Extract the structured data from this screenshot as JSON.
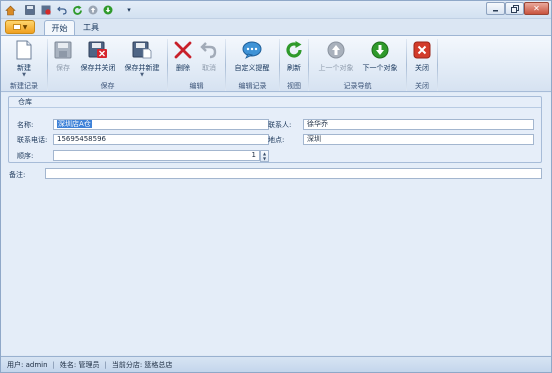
{
  "titlebar": {
    "controls": [
      "minimize",
      "restore",
      "close"
    ],
    "close_glyph": "✕"
  },
  "tabs": [
    {
      "label": "开始",
      "active": true
    },
    {
      "label": "工具",
      "active": false
    }
  ],
  "ribbon": {
    "groups": {
      "new_record": "新建记录",
      "save": "保存",
      "edit": "编辑",
      "edit_record": "编辑记录",
      "view": "视图",
      "record_nav": "记录导航",
      "close": "关闭"
    },
    "buttons": {
      "new": "新建",
      "save": "保存",
      "save_close": "保存并关闭",
      "save_new": "保存并新建",
      "delete": "删除",
      "cancel": "取消",
      "custom_hint": "自定义提醒",
      "refresh": "刷新",
      "prev": "上一个对象",
      "next": "下一个对象",
      "close": "关闭"
    }
  },
  "form": {
    "group_title": "仓库",
    "name_label": "名称:",
    "name_value": "深圳店A仓",
    "contact_label": "联系人:",
    "contact_value": "徐华乔",
    "phone_label": "联系电话:",
    "phone_value": "15695458596",
    "location_label": "地点:",
    "location_value": "深圳",
    "order_label": "顺序:",
    "order_value": "1",
    "note_label": "备注:",
    "note_value": ""
  },
  "status": {
    "user": "用户: admin",
    "name": "姓名: 管理员",
    "branch": "当前分店: 篮格总店"
  },
  "colors": {
    "accent": "#3f82d8",
    "ribbon_bg": "#dfe9f5",
    "delete_red": "#c8202a",
    "go_green": "#2f9a2b",
    "close_red": "#d23b2a"
  }
}
